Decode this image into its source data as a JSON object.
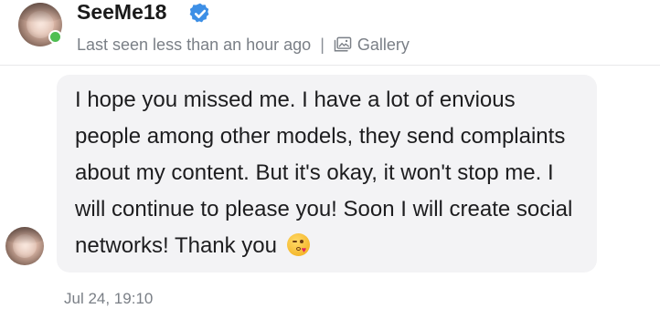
{
  "header": {
    "username": "SeeMe18",
    "status": "Last seen less than an hour ago",
    "separator": "|",
    "gallery_label": "Gallery",
    "online_color": "#4fbe52",
    "verified_color": "#3d8fe6"
  },
  "message": {
    "text": "I hope you missed me. I have a lot of envious people among other models, they send complaints about my content. But it's okay, it won't stop me. I will continue to please you! Soon I will create social networks! Thank you",
    "emoji": "face-blowing-a-kiss-emoji",
    "timestamp": "Jul 24, 19:10"
  }
}
